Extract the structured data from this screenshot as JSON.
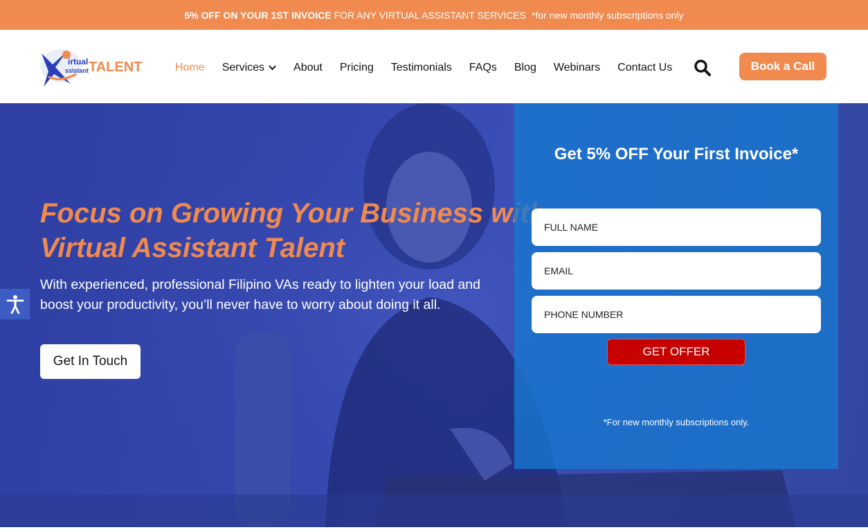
{
  "promo": {
    "bold": "5% OFF ON YOUR 1ST INVOICE",
    "text": "FOR ANY VIRTUAL ASSISTANT SERVICES",
    "note": "*for new monthly subscriptions only"
  },
  "logo": {
    "line1": "irtual",
    "line2": "ssistant",
    "brand": "TALENT"
  },
  "nav": {
    "items": [
      {
        "label": "Home",
        "active": true
      },
      {
        "label": "Services",
        "dropdown": true
      },
      {
        "label": "About"
      },
      {
        "label": "Pricing"
      },
      {
        "label": "Testimonials"
      },
      {
        "label": "FAQs"
      },
      {
        "label": "Blog"
      },
      {
        "label": "Webinars"
      },
      {
        "label": "Contact Us"
      }
    ],
    "search_icon": "search-icon",
    "cta": "Book a Call"
  },
  "hero": {
    "title_line1": "Focus on Growing Your Business with",
    "title_line2": "Virtual Assistant Talent",
    "sub_line1": "With experienced, professional Filipino VAs ready to lighten your load and",
    "sub_line2": "boost your productivity, you’ll never have to worry about doing it all.",
    "cta": "Get In Touch"
  },
  "form": {
    "title": "Get 5% OFF Your First Invoice*",
    "fields": [
      {
        "placeholder": "FULL NAME"
      },
      {
        "placeholder": "EMAIL"
      },
      {
        "placeholder": "PHONE NUMBER"
      }
    ],
    "submit": "GET OFFER",
    "note": "*For new monthly subscriptions only."
  },
  "colors": {
    "accent": "#F08A4E",
    "hero_blue": "#3446AD",
    "panel_blue": "#1876CE",
    "submit_red": "#C70000"
  }
}
